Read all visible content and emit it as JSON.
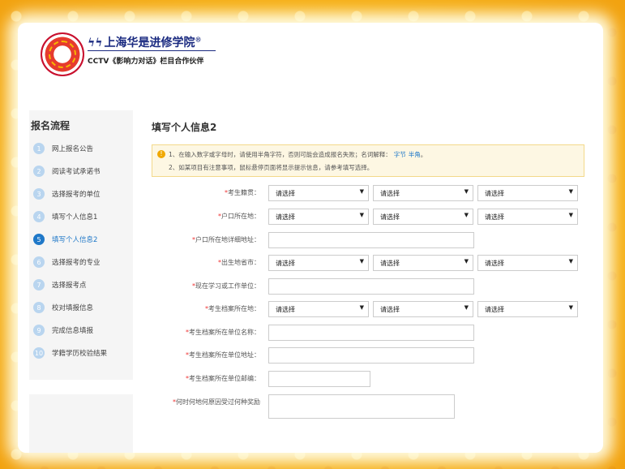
{
  "brand": {
    "title": "上海华是进修学院",
    "reg_mark": "®",
    "subtitle": "CCTV《影响力对话》栏目合作伙伴"
  },
  "sidebar": {
    "title": "报名流程",
    "steps": [
      {
        "num": "1",
        "label": "网上报名公告"
      },
      {
        "num": "2",
        "label": "阅读考试承诺书"
      },
      {
        "num": "3",
        "label": "选择报考的单位"
      },
      {
        "num": "4",
        "label": "填写个人信息1"
      },
      {
        "num": "5",
        "label": "填写个人信息2"
      },
      {
        "num": "6",
        "label": "选择报考的专业"
      },
      {
        "num": "7",
        "label": "选择报考点"
      },
      {
        "num": "8",
        "label": "校对填报信息"
      },
      {
        "num": "9",
        "label": "完成信息填报"
      },
      {
        "num": "10",
        "label": "学籍学历校验结果"
      }
    ]
  },
  "main": {
    "title": "填写个人信息2",
    "notice": {
      "line1": "1、在输入数字或字母时，请使用半角字符，否则可能会造成报名失败；名词解释：",
      "link1": "字节",
      "link2": "半角",
      "line1_end": "。",
      "line2": "2、如某项目有注意事项，鼠标悬停页面将显示提示信息，请参考填写选择。"
    },
    "select_placeholder": "请选择",
    "fields": [
      {
        "label": "考生籍贯："
      },
      {
        "label": "户口所在地："
      },
      {
        "label": "户口所在地详细地址："
      },
      {
        "label": "出生地省市："
      },
      {
        "label": "现在学习或工作单位："
      },
      {
        "label": "考生档案所在地："
      },
      {
        "label": "考生档案所在单位名称："
      },
      {
        "label": "考生档案所在单位地址："
      },
      {
        "label": "考生档案所在单位邮编："
      },
      {
        "label": "何时何地何原因受过何种奖励"
      }
    ],
    "required_mark": "*"
  },
  "colors": {
    "accent": "#1f78c8",
    "step_inactive": "#b9d5ef",
    "required": "#ee3333",
    "frame": "#f7b51b"
  }
}
